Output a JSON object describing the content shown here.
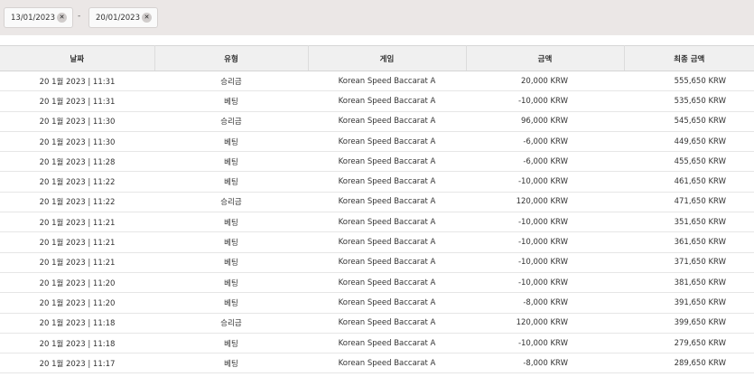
{
  "filter": {
    "date_from": "13/01/2023",
    "date_to": "20/01/2023",
    "separator": "-",
    "clear_glyph": "✕"
  },
  "table": {
    "headers": [
      "날짜",
      "유형",
      "게임",
      "금액",
      "최종 금액"
    ],
    "rows": [
      [
        "20 1월 2023 | 11:31",
        "승리금",
        "Korean Speed Baccarat A",
        "20,000 KRW",
        "555,650 KRW"
      ],
      [
        "20 1월 2023 | 11:31",
        "베팅",
        "Korean Speed Baccarat A",
        "-10,000 KRW",
        "535,650 KRW"
      ],
      [
        "20 1월 2023 | 11:30",
        "승리금",
        "Korean Speed Baccarat A",
        "96,000 KRW",
        "545,650 KRW"
      ],
      [
        "20 1월 2023 | 11:30",
        "베팅",
        "Korean Speed Baccarat A",
        "-6,000 KRW",
        "449,650 KRW"
      ],
      [
        "20 1월 2023 | 11:28",
        "베팅",
        "Korean Speed Baccarat A",
        "-6,000 KRW",
        "455,650 KRW"
      ],
      [
        "20 1월 2023 | 11:22",
        "베팅",
        "Korean Speed Baccarat A",
        "-10,000 KRW",
        "461,650 KRW"
      ],
      [
        "20 1월 2023 | 11:22",
        "승리금",
        "Korean Speed Baccarat A",
        "120,000 KRW",
        "471,650 KRW"
      ],
      [
        "20 1월 2023 | 11:21",
        "베팅",
        "Korean Speed Baccarat A",
        "-10,000 KRW",
        "351,650 KRW"
      ],
      [
        "20 1월 2023 | 11:21",
        "베팅",
        "Korean Speed Baccarat A",
        "-10,000 KRW",
        "361,650 KRW"
      ],
      [
        "20 1월 2023 | 11:21",
        "베팅",
        "Korean Speed Baccarat A",
        "-10,000 KRW",
        "371,650 KRW"
      ],
      [
        "20 1월 2023 | 11:20",
        "베팅",
        "Korean Speed Baccarat A",
        "-10,000 KRW",
        "381,650 KRW"
      ],
      [
        "20 1월 2023 | 11:20",
        "베팅",
        "Korean Speed Baccarat A",
        "-8,000 KRW",
        "391,650 KRW"
      ],
      [
        "20 1월 2023 | 11:18",
        "승리금",
        "Korean Speed Baccarat A",
        "120,000 KRW",
        "399,650 KRW"
      ],
      [
        "20 1월 2023 | 11:18",
        "베팅",
        "Korean Speed Baccarat A",
        "-10,000 KRW",
        "279,650 KRW"
      ],
      [
        "20 1월 2023 | 11:17",
        "베팅",
        "Korean Speed Baccarat A",
        "-8,000 KRW",
        "289,650 KRW"
      ]
    ]
  }
}
